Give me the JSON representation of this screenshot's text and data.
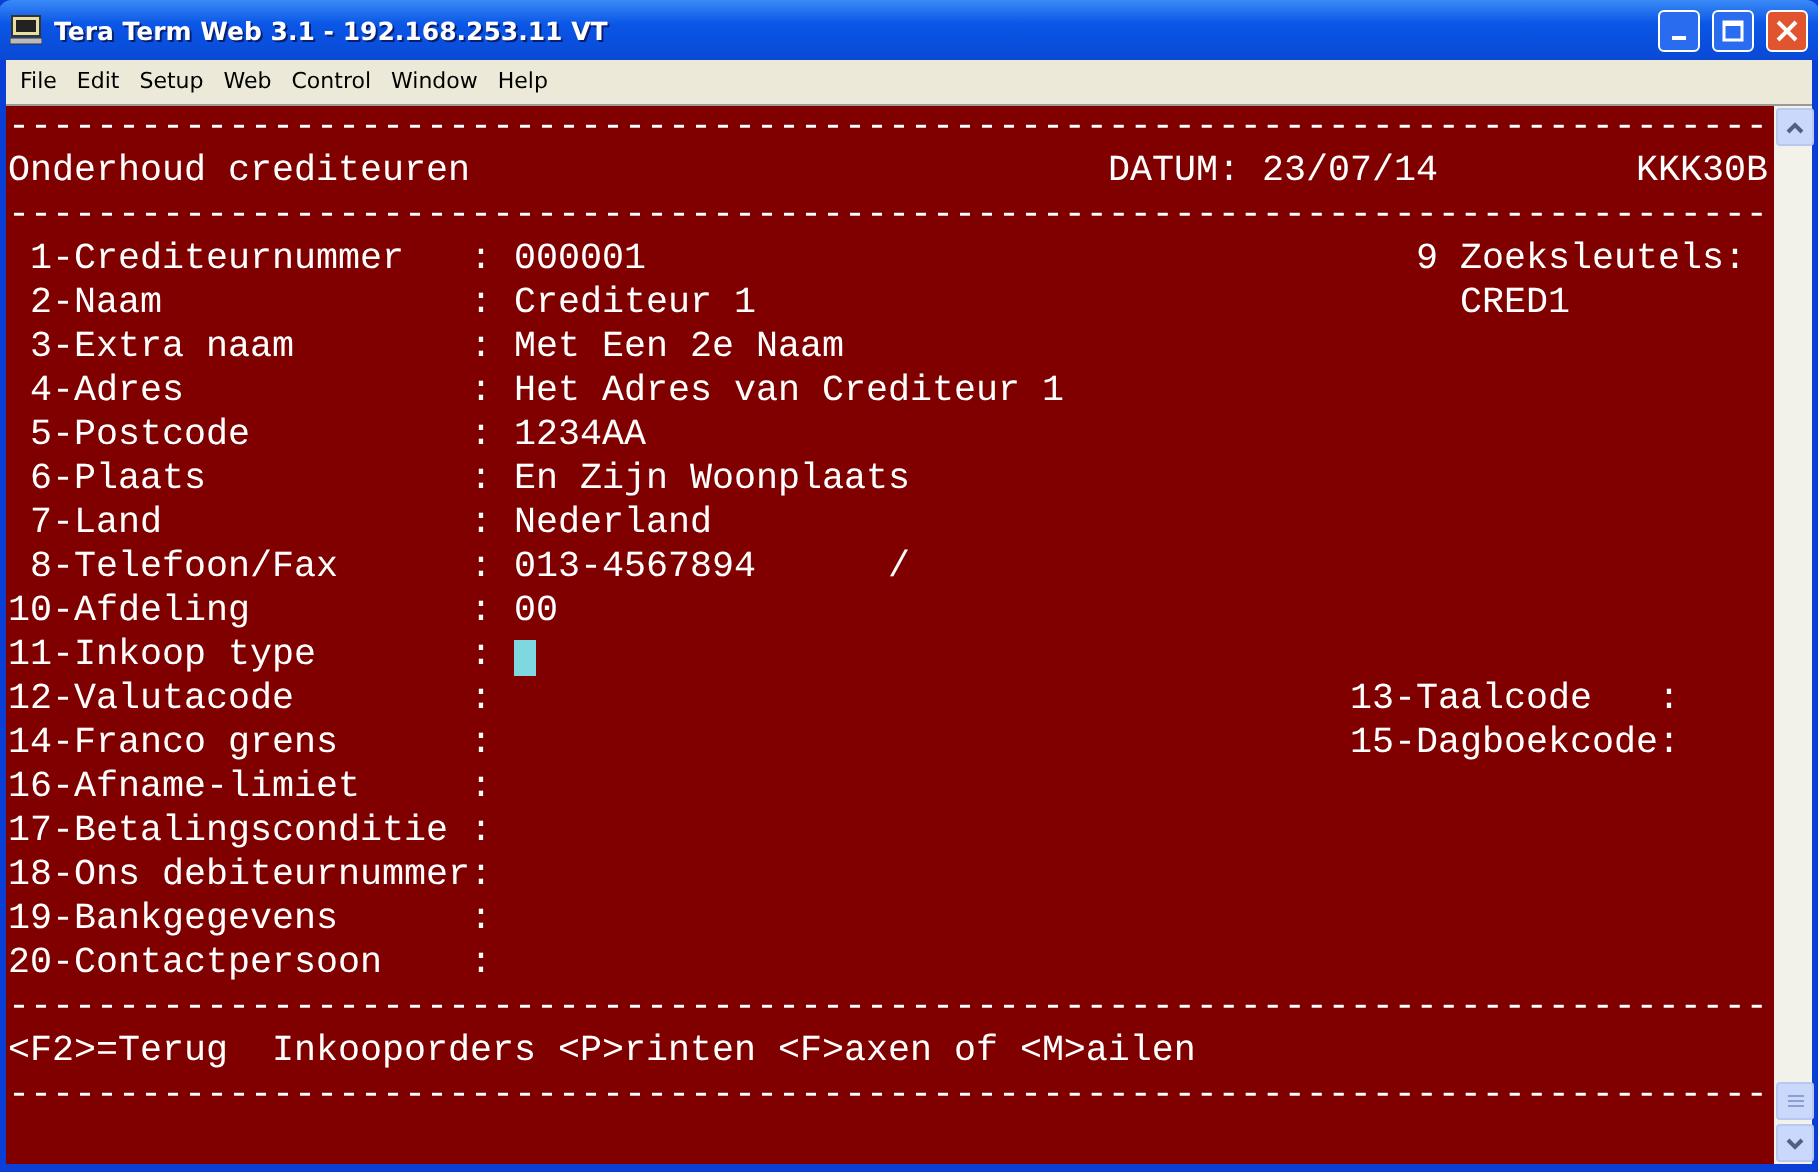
{
  "window": {
    "title": "Tera Term Web 3.1 - 192.168.253.11 VT"
  },
  "menu": [
    "File",
    "Edit",
    "Setup",
    "Web",
    "Control",
    "Window",
    "Help"
  ],
  "terminal": {
    "rules": [
      "--------------------------------------------------------------------------------",
      "--------------------------------------------------------------------------------",
      "--------------------------------------------------------------------------------",
      "--------------------------------------------------------------------------------"
    ],
    "header": {
      "title": "Onderhoud crediteuren",
      "date_label": "DATUM:",
      "date": "23/07/14",
      "code": "KKK30B"
    },
    "fields": [
      {
        "label": "1-Crediteurnummer",
        "colon": ":",
        "value": "000001",
        "side": {
          "kind": "heading",
          "text": "9 Zoeksleutels:"
        }
      },
      {
        "label": "2-Naam",
        "colon": ":",
        "value": "Crediteur 1",
        "side": {
          "kind": "value",
          "text": "CRED1"
        }
      },
      {
        "label": "3-Extra naam",
        "colon": ":",
        "value": "Met Een 2e Naam"
      },
      {
        "label": "4-Adres",
        "colon": ":",
        "value": "Het Adres van Crediteur 1"
      },
      {
        "label": "5-Postcode",
        "colon": ":",
        "value": "1234AA"
      },
      {
        "label": "6-Plaats",
        "colon": ":",
        "value": "En Zijn Woonplaats"
      },
      {
        "label": "7-Land",
        "colon": ":",
        "value": "Nederland"
      },
      {
        "label": "8-Telefoon/Fax",
        "colon": ":",
        "value": "013-4567894",
        "value_2": "/"
      },
      {
        "label": "10-Afdeling",
        "colon": ":",
        "value": "00"
      },
      {
        "label": "11-Inkoop type",
        "colon": ":",
        "cursor": true
      },
      {
        "label": "12-Valutacode",
        "colon": ":",
        "side": {
          "kind": "field",
          "text": "13-Taalcode",
          "colon": ":"
        }
      },
      {
        "label": "14-Franco grens",
        "colon": ":",
        "side": {
          "kind": "field",
          "text": "15-Dagboekcode",
          "colon": ":"
        }
      },
      {
        "label": "16-Afname-limiet",
        "colon": ":"
      },
      {
        "label": "17-Betalingsconditie",
        "colon": ":"
      },
      {
        "label": "18-Ons debiteurnummer",
        "colon": ":"
      },
      {
        "label": "19-Bankgegevens",
        "colon": ":"
      },
      {
        "label": "20-Contactpersoon",
        "colon": ":"
      }
    ],
    "footer": "<F2>=Terug  Inkooporders <P>rinten <F>axen of <M>ailen"
  }
}
